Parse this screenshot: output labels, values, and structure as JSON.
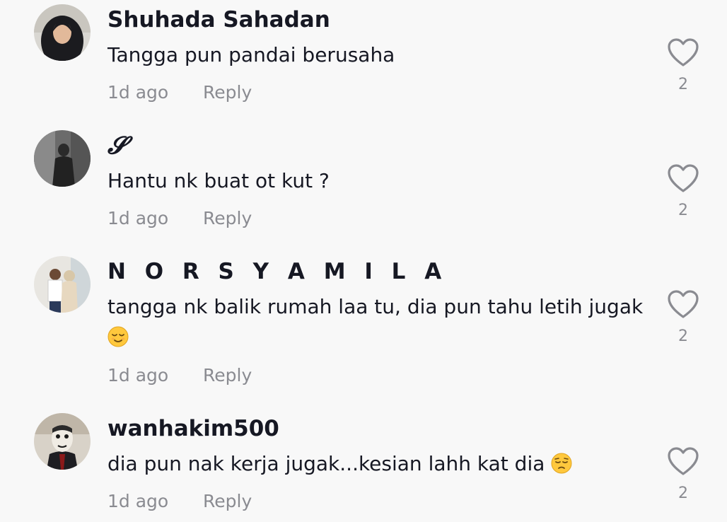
{
  "comments": [
    {
      "username": "Shuhada Sahadan",
      "text": "Tangga pun pandai berusaha",
      "emoji": "",
      "time": "1d ago",
      "reply_label": "Reply",
      "likes": "2",
      "avatar_icon": "avatar-woman-hijab"
    },
    {
      "username": "𝓢",
      "text": "Hantu nk buat ot kut ?",
      "emoji": "",
      "time": "1d ago",
      "reply_label": "Reply",
      "likes": "2",
      "avatar_icon": "avatar-dark-figure"
    },
    {
      "username": "N O R S Y A M I L A",
      "text": "tangga nk balik rumah laa tu, dia pun tahu letih jugak",
      "emoji": "relieved-face-emoji",
      "time": "1d ago",
      "reply_label": "Reply",
      "likes": "2",
      "avatar_icon": "avatar-couple"
    },
    {
      "username": "wanhakim500",
      "text": "dia pun nak kerja jugak...kesian lahh kat dia",
      "emoji": "pensive-face-emoji",
      "time": "1d ago",
      "reply_label": "Reply",
      "likes": "2",
      "avatar_icon": "avatar-mask"
    }
  ],
  "colors": {
    "background": "#f8f8f8",
    "primary_text": "#161823",
    "secondary_text": "#8a8b91",
    "like_icon": "#8a8b91",
    "emoji_face": "#ffc83d"
  }
}
